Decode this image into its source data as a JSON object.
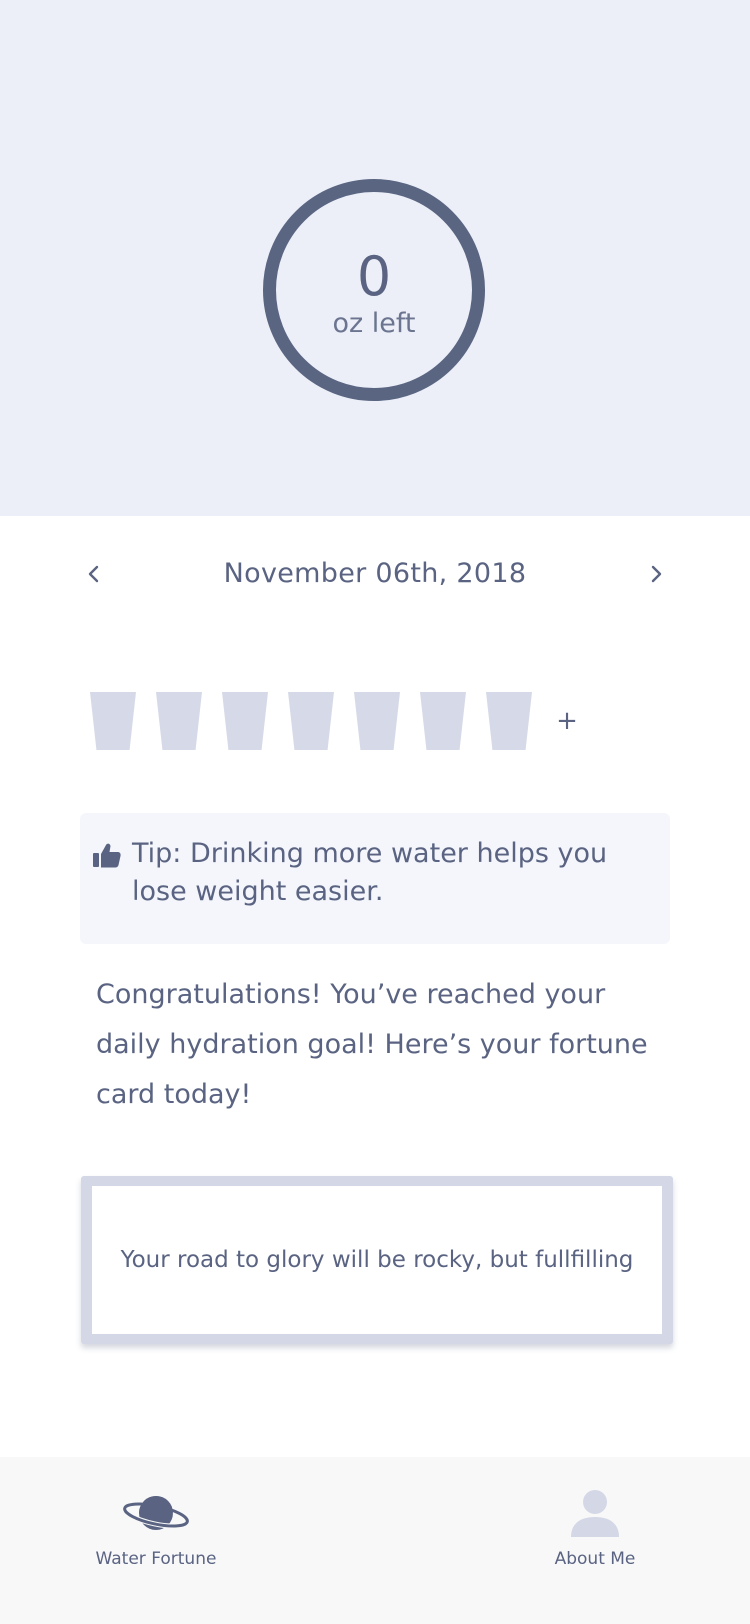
{
  "progress": {
    "value": "0",
    "unit": "oz left"
  },
  "date_nav": {
    "date": "November 06th, 2018",
    "prev_icon": "chevron-left-icon",
    "next_icon": "chevron-right-icon"
  },
  "cups": {
    "count": 7,
    "add_label": "+"
  },
  "tip": {
    "icon": "thumbs-up-icon",
    "text": "Tip: Drinking more water helps you lose weight easier."
  },
  "congrats": {
    "text": "Congratulations! You’ve reached your daily hydration goal! Here’s your fortune card today!"
  },
  "fortune_card": {
    "text": "Your road to glory will be rocky, but fullfilling"
  },
  "tabbar": {
    "items": [
      {
        "label": "Water Fortune",
        "icon": "planet-icon"
      },
      {
        "label": "About Me",
        "icon": "user-icon"
      }
    ]
  },
  "colors": {
    "hero_bg": "#eceff8",
    "ring": "#5a6582",
    "text": "#5a6482",
    "cup": "#d6d9e7",
    "tip_bg": "#f4f6fb",
    "card_border": "#d3d7e6",
    "tabbar_bg": "#f8f8f9",
    "inactive_icon": "#d4d8e6"
  }
}
